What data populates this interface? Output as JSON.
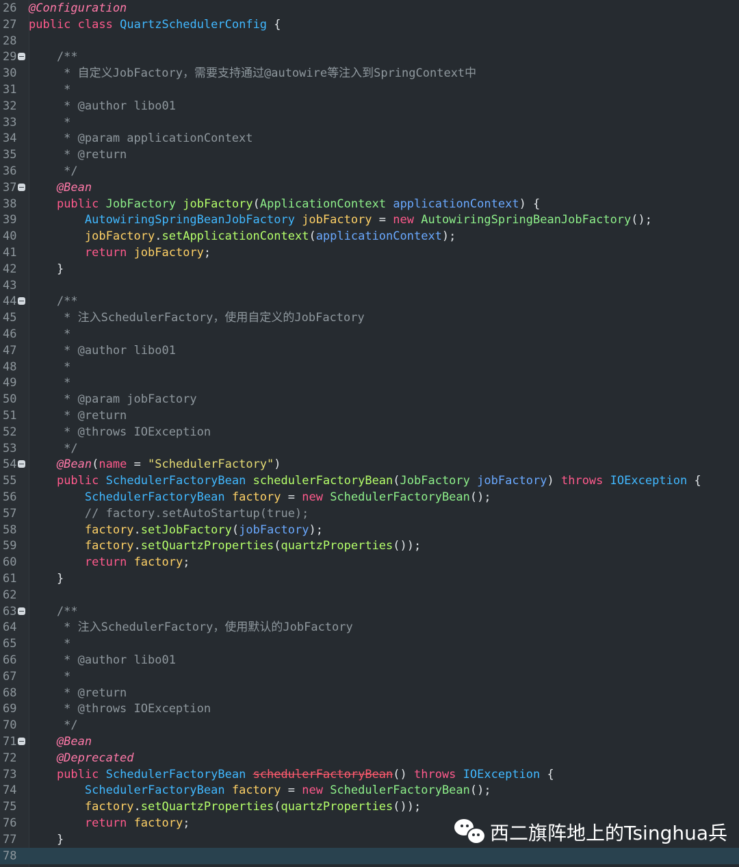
{
  "lines": [
    {
      "n": "26",
      "f": false,
      "t": [
        [
          "@Configuration",
          "anno"
        ]
      ]
    },
    {
      "n": "27",
      "f": false,
      "t": [
        [
          "public",
          "kw"
        ],
        [
          " ",
          ""
        ],
        [
          "class",
          "kw"
        ],
        [
          " ",
          ""
        ],
        [
          "QuartzSchedulerConfig",
          "type"
        ],
        [
          " {",
          ""
        ]
      ]
    },
    {
      "n": "28",
      "f": false,
      "t": []
    },
    {
      "n": "29",
      "f": true,
      "t": [
        [
          "    /**",
          "com"
        ]
      ]
    },
    {
      "n": "30",
      "f": false,
      "t": [
        [
          "     * 自定义JobFactory，需要支持通过@autowire等注入到SpringContext中",
          "com"
        ]
      ]
    },
    {
      "n": "31",
      "f": false,
      "t": [
        [
          "     *",
          "com"
        ]
      ]
    },
    {
      "n": "32",
      "f": false,
      "t": [
        [
          "     * @author libo01",
          "com"
        ]
      ]
    },
    {
      "n": "33",
      "f": false,
      "t": [
        [
          "     *",
          "com"
        ]
      ]
    },
    {
      "n": "34",
      "f": false,
      "t": [
        [
          "     * @param applicationContext",
          "com"
        ]
      ]
    },
    {
      "n": "35",
      "f": false,
      "t": [
        [
          "     * @return",
          "com"
        ]
      ]
    },
    {
      "n": "36",
      "f": false,
      "t": [
        [
          "     */",
          "com"
        ]
      ]
    },
    {
      "n": "37",
      "f": true,
      "t": [
        [
          "    @Bean",
          "anno"
        ]
      ]
    },
    {
      "n": "38",
      "f": false,
      "t": [
        [
          "    ",
          ""
        ],
        [
          "public",
          "kw"
        ],
        [
          " ",
          ""
        ],
        [
          "JobFactory",
          "cls"
        ],
        [
          " ",
          ""
        ],
        [
          "jobFactory",
          "method"
        ],
        [
          "(",
          ""
        ],
        [
          "ApplicationContext",
          "cls"
        ],
        [
          " ",
          ""
        ],
        [
          "applicationContext",
          "param"
        ],
        [
          ") {",
          ""
        ]
      ]
    },
    {
      "n": "39",
      "f": false,
      "t": [
        [
          "        ",
          ""
        ],
        [
          "AutowiringSpringBeanJobFactory",
          "type"
        ],
        [
          " ",
          ""
        ],
        [
          "jobFactory",
          "var"
        ],
        [
          " = ",
          ""
        ],
        [
          "new",
          "kw"
        ],
        [
          " ",
          ""
        ],
        [
          "AutowiringSpringBeanJobFactory",
          "cls"
        ],
        [
          "();",
          ""
        ]
      ]
    },
    {
      "n": "40",
      "f": false,
      "t": [
        [
          "        ",
          ""
        ],
        [
          "jobFactory",
          "var"
        ],
        [
          ".",
          ""
        ],
        [
          "setApplicationContext",
          "method"
        ],
        [
          "(",
          ""
        ],
        [
          "applicationContext",
          "param"
        ],
        [
          ");",
          ""
        ]
      ]
    },
    {
      "n": "41",
      "f": false,
      "t": [
        [
          "        ",
          ""
        ],
        [
          "return",
          "kw"
        ],
        [
          " ",
          ""
        ],
        [
          "jobFactory",
          "var"
        ],
        [
          ";",
          ""
        ]
      ]
    },
    {
      "n": "42",
      "f": false,
      "t": [
        [
          "    }",
          ""
        ]
      ]
    },
    {
      "n": "43",
      "f": false,
      "t": []
    },
    {
      "n": "44",
      "f": true,
      "t": [
        [
          "    /**",
          "com"
        ]
      ]
    },
    {
      "n": "45",
      "f": false,
      "t": [
        [
          "     * 注入SchedulerFactory，使用自定义的JobFactory",
          "com"
        ]
      ]
    },
    {
      "n": "46",
      "f": false,
      "t": [
        [
          "     *",
          "com"
        ]
      ]
    },
    {
      "n": "47",
      "f": false,
      "t": [
        [
          "     * @author libo01",
          "com"
        ]
      ]
    },
    {
      "n": "48",
      "f": false,
      "t": [
        [
          "     *",
          "com"
        ]
      ]
    },
    {
      "n": "49",
      "f": false,
      "t": [
        [
          "     *",
          "com"
        ]
      ]
    },
    {
      "n": "50",
      "f": false,
      "t": [
        [
          "     * @param jobFactory",
          "com"
        ]
      ]
    },
    {
      "n": "51",
      "f": false,
      "t": [
        [
          "     * @return",
          "com"
        ]
      ]
    },
    {
      "n": "52",
      "f": false,
      "t": [
        [
          "     * @throws IOException",
          "com"
        ]
      ]
    },
    {
      "n": "53",
      "f": false,
      "t": [
        [
          "     */",
          "com"
        ]
      ]
    },
    {
      "n": "54",
      "f": true,
      "t": [
        [
          "    @Bean",
          "anno"
        ],
        [
          "(",
          ""
        ],
        [
          "name",
          "kw"
        ],
        [
          " = ",
          ""
        ],
        [
          "\"SchedulerFactory\"",
          "str"
        ],
        [
          ")",
          ""
        ]
      ]
    },
    {
      "n": "55",
      "f": false,
      "t": [
        [
          "    ",
          ""
        ],
        [
          "public",
          "kw"
        ],
        [
          " ",
          ""
        ],
        [
          "SchedulerFactoryBean",
          "type"
        ],
        [
          " ",
          ""
        ],
        [
          "schedulerFactoryBean",
          "method"
        ],
        [
          "(",
          ""
        ],
        [
          "JobFactory",
          "cls"
        ],
        [
          " ",
          ""
        ],
        [
          "jobFactory",
          "param"
        ],
        [
          ") ",
          ""
        ],
        [
          "throws",
          "kw"
        ],
        [
          " ",
          ""
        ],
        [
          "IOException",
          "type"
        ],
        [
          " {",
          ""
        ]
      ]
    },
    {
      "n": "56",
      "f": false,
      "t": [
        [
          "        ",
          ""
        ],
        [
          "SchedulerFactoryBean",
          "type"
        ],
        [
          " ",
          ""
        ],
        [
          "factory",
          "var"
        ],
        [
          " = ",
          ""
        ],
        [
          "new",
          "kw"
        ],
        [
          " ",
          ""
        ],
        [
          "SchedulerFactoryBean",
          "cls"
        ],
        [
          "();",
          ""
        ]
      ]
    },
    {
      "n": "57",
      "f": false,
      "t": [
        [
          "        // factory.setAutoStartup(true);",
          "com"
        ]
      ]
    },
    {
      "n": "58",
      "f": false,
      "t": [
        [
          "        ",
          ""
        ],
        [
          "factory",
          "var"
        ],
        [
          ".",
          ""
        ],
        [
          "setJobFactory",
          "method"
        ],
        [
          "(",
          ""
        ],
        [
          "jobFactory",
          "param"
        ],
        [
          ");",
          ""
        ]
      ]
    },
    {
      "n": "59",
      "f": false,
      "t": [
        [
          "        ",
          ""
        ],
        [
          "factory",
          "var"
        ],
        [
          ".",
          ""
        ],
        [
          "setQuartzProperties",
          "method"
        ],
        [
          "(",
          ""
        ],
        [
          "quartzProperties",
          "method"
        ],
        [
          "());",
          ""
        ]
      ]
    },
    {
      "n": "60",
      "f": false,
      "t": [
        [
          "        ",
          ""
        ],
        [
          "return",
          "kw"
        ],
        [
          " ",
          ""
        ],
        [
          "factory",
          "var"
        ],
        [
          ";",
          ""
        ]
      ]
    },
    {
      "n": "61",
      "f": false,
      "t": [
        [
          "    }",
          ""
        ]
      ]
    },
    {
      "n": "62",
      "f": false,
      "t": []
    },
    {
      "n": "63",
      "f": true,
      "t": [
        [
          "    /**",
          "com"
        ]
      ]
    },
    {
      "n": "64",
      "f": false,
      "t": [
        [
          "     * 注入SchedulerFactory，使用默认的JobFactory",
          "com"
        ]
      ]
    },
    {
      "n": "65",
      "f": false,
      "t": [
        [
          "     *",
          "com"
        ]
      ]
    },
    {
      "n": "66",
      "f": false,
      "t": [
        [
          "     * @author libo01",
          "com"
        ]
      ]
    },
    {
      "n": "67",
      "f": false,
      "t": [
        [
          "     *",
          "com"
        ]
      ]
    },
    {
      "n": "68",
      "f": false,
      "t": [
        [
          "     * @return",
          "com"
        ]
      ]
    },
    {
      "n": "69",
      "f": false,
      "t": [
        [
          "     * @throws IOException",
          "com"
        ]
      ]
    },
    {
      "n": "70",
      "f": false,
      "t": [
        [
          "     */",
          "com"
        ]
      ]
    },
    {
      "n": "71",
      "f": true,
      "t": [
        [
          "    @Bean",
          "anno"
        ]
      ]
    },
    {
      "n": "72",
      "f": false,
      "t": [
        [
          "    @Deprecated",
          "anno"
        ]
      ]
    },
    {
      "n": "73",
      "f": false,
      "t": [
        [
          "    ",
          ""
        ],
        [
          "public",
          "kw"
        ],
        [
          " ",
          ""
        ],
        [
          "SchedulerFactoryBean",
          "type"
        ],
        [
          " ",
          ""
        ],
        [
          "schedulerFactoryBean",
          "dep"
        ],
        [
          "() ",
          ""
        ],
        [
          "throws",
          "kw"
        ],
        [
          " ",
          ""
        ],
        [
          "IOException",
          "type"
        ],
        [
          " {",
          ""
        ]
      ]
    },
    {
      "n": "74",
      "f": false,
      "t": [
        [
          "        ",
          ""
        ],
        [
          "SchedulerFactoryBean",
          "type"
        ],
        [
          " ",
          ""
        ],
        [
          "factory",
          "var"
        ],
        [
          " = ",
          ""
        ],
        [
          "new",
          "kw"
        ],
        [
          " ",
          ""
        ],
        [
          "SchedulerFactoryBean",
          "cls"
        ],
        [
          "();",
          ""
        ]
      ]
    },
    {
      "n": "75",
      "f": false,
      "t": [
        [
          "        ",
          ""
        ],
        [
          "factory",
          "var"
        ],
        [
          ".",
          ""
        ],
        [
          "setQuartzProperties",
          "method"
        ],
        [
          "(",
          ""
        ],
        [
          "quartzProperties",
          "method"
        ],
        [
          "());",
          ""
        ]
      ]
    },
    {
      "n": "76",
      "f": false,
      "t": [
        [
          "        ",
          ""
        ],
        [
          "return",
          "kw"
        ],
        [
          " ",
          ""
        ],
        [
          "factory",
          "var"
        ],
        [
          ";",
          ""
        ]
      ]
    },
    {
      "n": "77",
      "f": false,
      "t": [
        [
          "    }",
          ""
        ]
      ]
    },
    {
      "n": "78",
      "f": false,
      "current": true,
      "t": []
    }
  ],
  "watermark": {
    "text": "西二旗阵地上的Tsinghua兵",
    "icon": "wechat-icon"
  }
}
